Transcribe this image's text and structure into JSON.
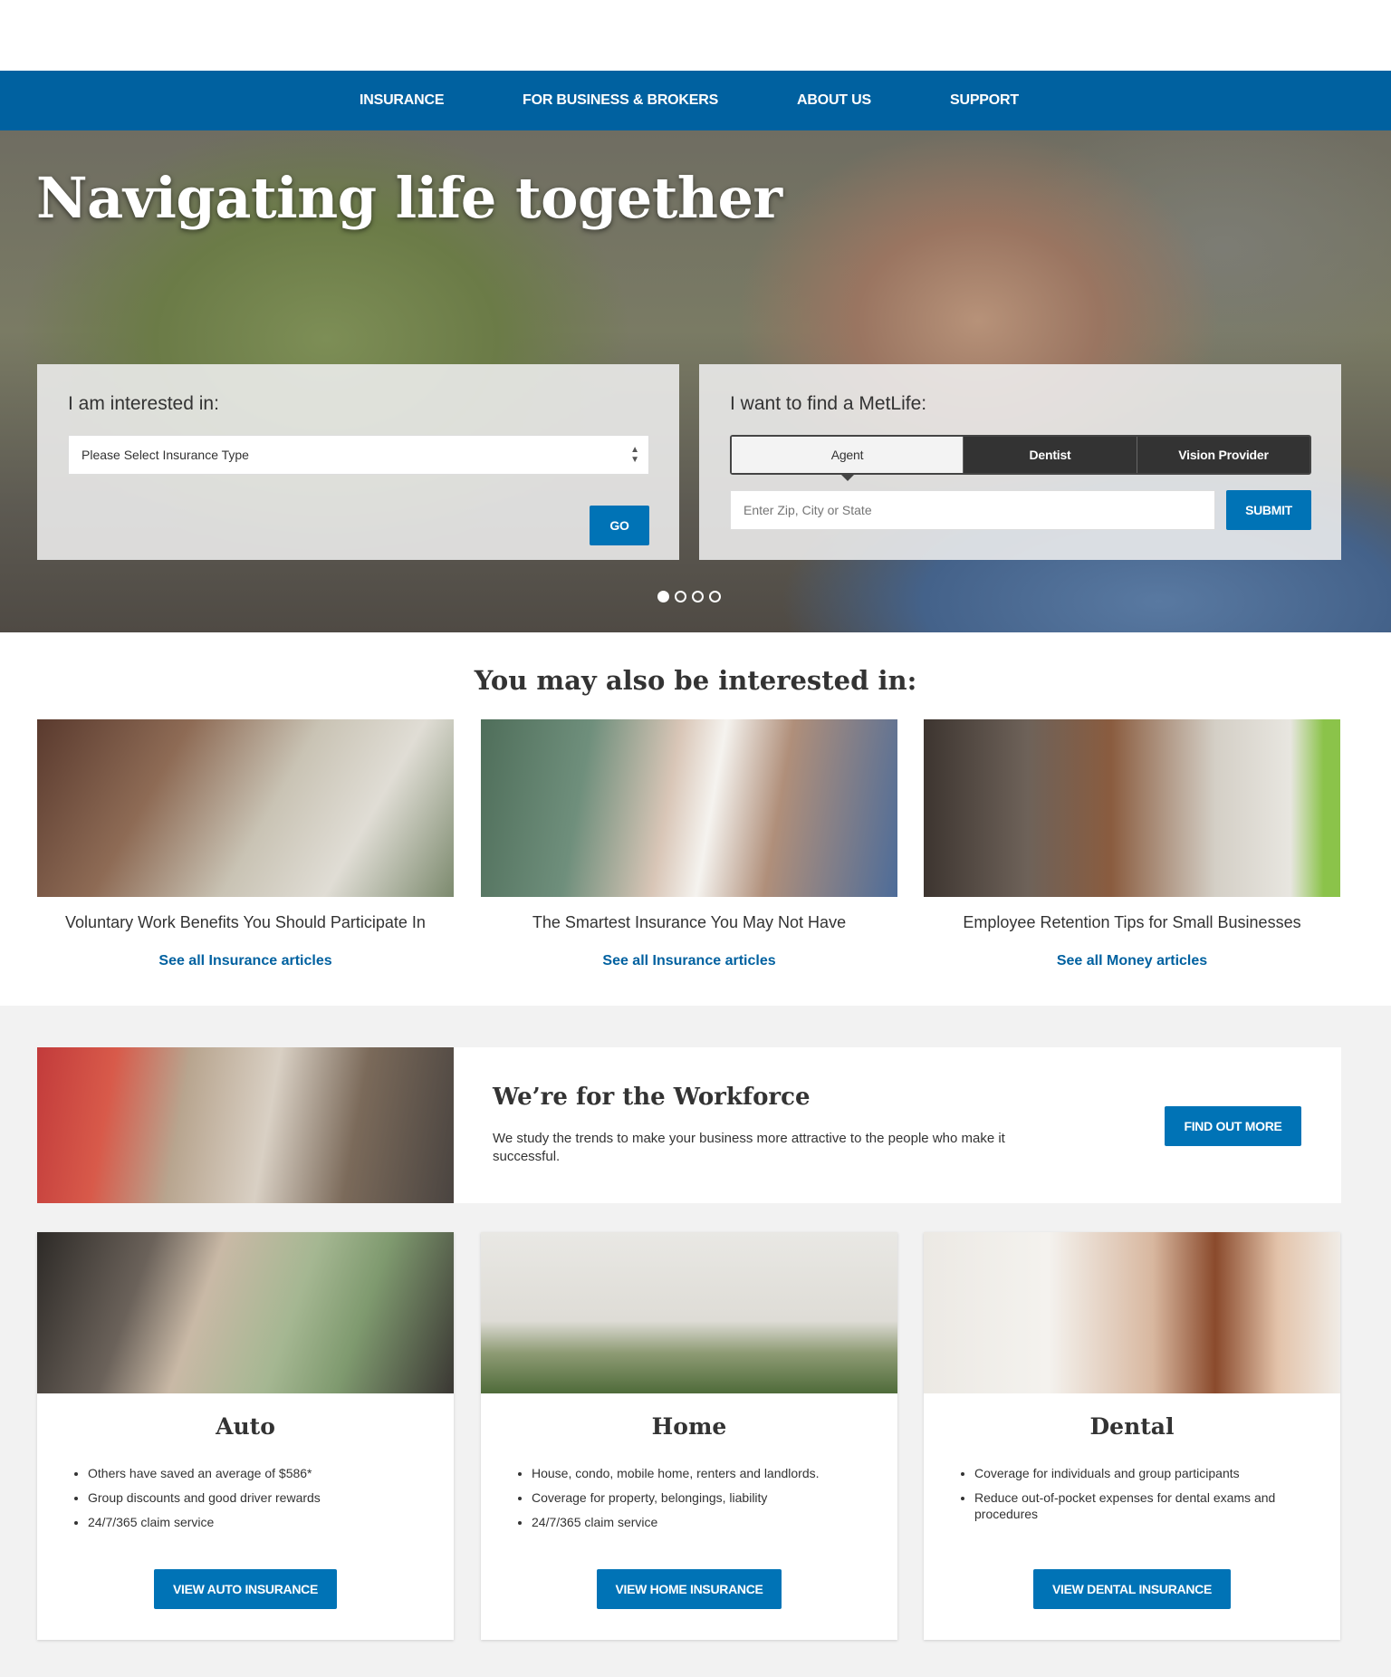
{
  "nav": {
    "items": [
      "INSURANCE",
      "FOR BUSINESS & BROKERS",
      "ABOUT US",
      "SUPPORT"
    ]
  },
  "hero": {
    "title": "Navigating life together",
    "interest_panel": {
      "label": "I am interested in:",
      "select_value": "Please Select Insurance Type",
      "go_label": "GO"
    },
    "find_panel": {
      "label": "I want to find a MetLife:",
      "tabs": [
        "Agent",
        "Dentist",
        "Vision Provider"
      ],
      "active_tab": "Agent",
      "zip_placeholder": "Enter Zip, City or State",
      "submit_label": "SUBMIT"
    },
    "carousel_dots": 4,
    "carousel_active": 1
  },
  "interested": {
    "title": "You may also be interested in:",
    "cards": [
      {
        "title": "Voluntary Work Benefits You Should Participate In",
        "link": "See all Insurance articles"
      },
      {
        "title": "The Smartest Insurance You May Not Have",
        "link": "See all Insurance articles"
      },
      {
        "title": "Employee Retention Tips for Small Businesses",
        "link": "See all Money articles"
      }
    ]
  },
  "workforce": {
    "title": "We’re for the Workforce",
    "text": "We study the trends to make your business more attractive to the people who make it successful.",
    "button": "FIND OUT MORE"
  },
  "insurance_cards": [
    {
      "title": "Auto",
      "bullets": [
        "Others have saved an average of $586*",
        "Group discounts and good driver rewards",
        "24/7/365 claim service"
      ],
      "button": "VIEW AUTO INSURANCE"
    },
    {
      "title": "Home",
      "bullets": [
        "House, condo, mobile home, renters and landlords.",
        "Coverage for property, belongings, liability",
        "24/7/365 claim service"
      ],
      "button": "VIEW HOME INSURANCE"
    },
    {
      "title": "Dental",
      "bullets": [
        "Coverage for individuals and group participants",
        "Reduce out-of-pocket expenses for dental exams and procedures"
      ],
      "button": "VIEW DENTAL INSURANCE"
    }
  ],
  "colors": {
    "brand_blue": "#0061a0",
    "button_blue": "#0073b6",
    "link_blue": "#0061a0",
    "section_gray": "#f2f2f2"
  }
}
